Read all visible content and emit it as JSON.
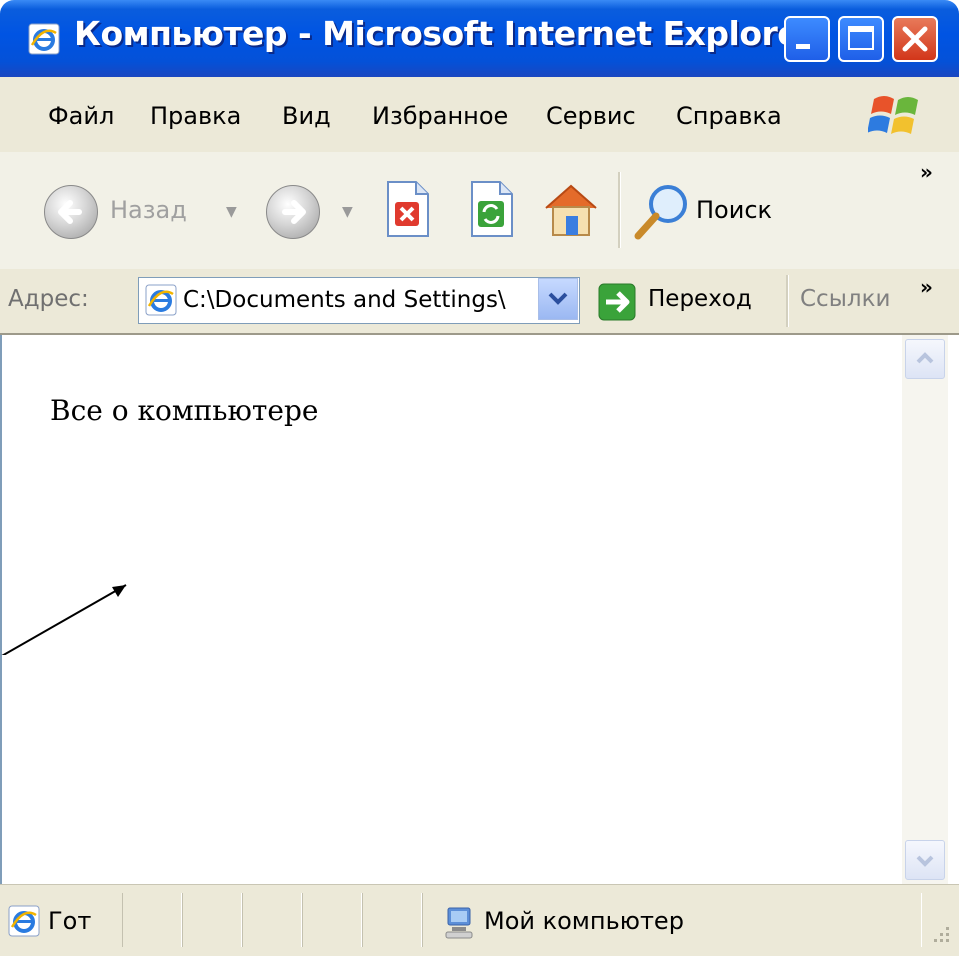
{
  "window": {
    "title": "Компьютер - Microsoft Internet Explorer"
  },
  "menubar": {
    "items": [
      "Файл",
      "Правка",
      "Вид",
      "Избранное",
      "Сервис",
      "Справка"
    ]
  },
  "toolbar": {
    "back_label": "Назад",
    "search_label": "Поиск",
    "more_chevron": "»"
  },
  "addressbar": {
    "label": "Адрес:",
    "value": "C:\\Documents and Settings\\",
    "go_label": "Переход",
    "links_label": "Ссылки",
    "links_chevron": "»"
  },
  "content": {
    "heading": "Все о компьютере"
  },
  "statusbar": {
    "status_text": "Гот",
    "zone_text": "Мой компьютер"
  },
  "colors": {
    "titlebar": "#0054e3",
    "chrome": "#ece9d8",
    "close_button": "#d2361a"
  }
}
